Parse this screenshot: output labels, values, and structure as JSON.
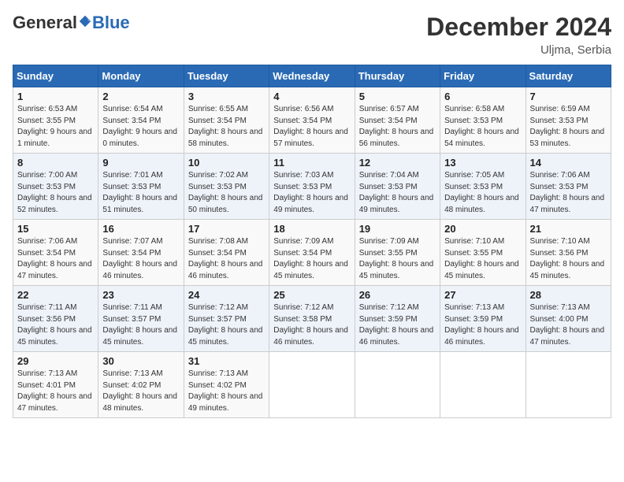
{
  "header": {
    "logo_general": "General",
    "logo_blue": "Blue",
    "month_title": "December 2024",
    "location": "Uljma, Serbia"
  },
  "days_of_week": [
    "Sunday",
    "Monday",
    "Tuesday",
    "Wednesday",
    "Thursday",
    "Friday",
    "Saturday"
  ],
  "weeks": [
    [
      {
        "day": "1",
        "sunrise": "6:53 AM",
        "sunset": "3:55 PM",
        "daylight": "9 hours and 1 minute."
      },
      {
        "day": "2",
        "sunrise": "6:54 AM",
        "sunset": "3:54 PM",
        "daylight": "9 hours and 0 minutes."
      },
      {
        "day": "3",
        "sunrise": "6:55 AM",
        "sunset": "3:54 PM",
        "daylight": "8 hours and 58 minutes."
      },
      {
        "day": "4",
        "sunrise": "6:56 AM",
        "sunset": "3:54 PM",
        "daylight": "8 hours and 57 minutes."
      },
      {
        "day": "5",
        "sunrise": "6:57 AM",
        "sunset": "3:54 PM",
        "daylight": "8 hours and 56 minutes."
      },
      {
        "day": "6",
        "sunrise": "6:58 AM",
        "sunset": "3:53 PM",
        "daylight": "8 hours and 54 minutes."
      },
      {
        "day": "7",
        "sunrise": "6:59 AM",
        "sunset": "3:53 PM",
        "daylight": "8 hours and 53 minutes."
      }
    ],
    [
      {
        "day": "8",
        "sunrise": "7:00 AM",
        "sunset": "3:53 PM",
        "daylight": "8 hours and 52 minutes."
      },
      {
        "day": "9",
        "sunrise": "7:01 AM",
        "sunset": "3:53 PM",
        "daylight": "8 hours and 51 minutes."
      },
      {
        "day": "10",
        "sunrise": "7:02 AM",
        "sunset": "3:53 PM",
        "daylight": "8 hours and 50 minutes."
      },
      {
        "day": "11",
        "sunrise": "7:03 AM",
        "sunset": "3:53 PM",
        "daylight": "8 hours and 49 minutes."
      },
      {
        "day": "12",
        "sunrise": "7:04 AM",
        "sunset": "3:53 PM",
        "daylight": "8 hours and 49 minutes."
      },
      {
        "day": "13",
        "sunrise": "7:05 AM",
        "sunset": "3:53 PM",
        "daylight": "8 hours and 48 minutes."
      },
      {
        "day": "14",
        "sunrise": "7:06 AM",
        "sunset": "3:53 PM",
        "daylight": "8 hours and 47 minutes."
      }
    ],
    [
      {
        "day": "15",
        "sunrise": "7:06 AM",
        "sunset": "3:54 PM",
        "daylight": "8 hours and 47 minutes."
      },
      {
        "day": "16",
        "sunrise": "7:07 AM",
        "sunset": "3:54 PM",
        "daylight": "8 hours and 46 minutes."
      },
      {
        "day": "17",
        "sunrise": "7:08 AM",
        "sunset": "3:54 PM",
        "daylight": "8 hours and 46 minutes."
      },
      {
        "day": "18",
        "sunrise": "7:09 AM",
        "sunset": "3:54 PM",
        "daylight": "8 hours and 45 minutes."
      },
      {
        "day": "19",
        "sunrise": "7:09 AM",
        "sunset": "3:55 PM",
        "daylight": "8 hours and 45 minutes."
      },
      {
        "day": "20",
        "sunrise": "7:10 AM",
        "sunset": "3:55 PM",
        "daylight": "8 hours and 45 minutes."
      },
      {
        "day": "21",
        "sunrise": "7:10 AM",
        "sunset": "3:56 PM",
        "daylight": "8 hours and 45 minutes."
      }
    ],
    [
      {
        "day": "22",
        "sunrise": "7:11 AM",
        "sunset": "3:56 PM",
        "daylight": "8 hours and 45 minutes."
      },
      {
        "day": "23",
        "sunrise": "7:11 AM",
        "sunset": "3:57 PM",
        "daylight": "8 hours and 45 minutes."
      },
      {
        "day": "24",
        "sunrise": "7:12 AM",
        "sunset": "3:57 PM",
        "daylight": "8 hours and 45 minutes."
      },
      {
        "day": "25",
        "sunrise": "7:12 AM",
        "sunset": "3:58 PM",
        "daylight": "8 hours and 46 minutes."
      },
      {
        "day": "26",
        "sunrise": "7:12 AM",
        "sunset": "3:59 PM",
        "daylight": "8 hours and 46 minutes."
      },
      {
        "day": "27",
        "sunrise": "7:13 AM",
        "sunset": "3:59 PM",
        "daylight": "8 hours and 46 minutes."
      },
      {
        "day": "28",
        "sunrise": "7:13 AM",
        "sunset": "4:00 PM",
        "daylight": "8 hours and 47 minutes."
      }
    ],
    [
      {
        "day": "29",
        "sunrise": "7:13 AM",
        "sunset": "4:01 PM",
        "daylight": "8 hours and 47 minutes."
      },
      {
        "day": "30",
        "sunrise": "7:13 AM",
        "sunset": "4:02 PM",
        "daylight": "8 hours and 48 minutes."
      },
      {
        "day": "31",
        "sunrise": "7:13 AM",
        "sunset": "4:02 PM",
        "daylight": "8 hours and 49 minutes."
      },
      null,
      null,
      null,
      null
    ]
  ],
  "labels": {
    "sunrise": "Sunrise:",
    "sunset": "Sunset:",
    "daylight": "Daylight:"
  }
}
